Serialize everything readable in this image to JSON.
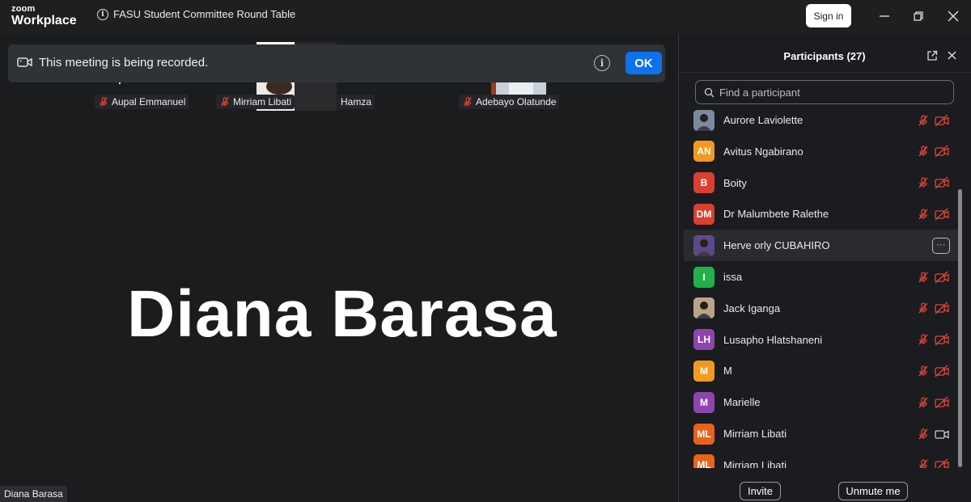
{
  "app": {
    "logo_line1": "zoom",
    "logo_line2": "Workplace",
    "meeting_title": "FASU Student Committee Round Table",
    "sign_in": "Sign in"
  },
  "recording_banner": {
    "text": "This meeting is being recorded.",
    "ok": "OK",
    "info_glyph": "i"
  },
  "video_tiles": [
    {
      "name": "Aupal Emmanuel",
      "muted": true
    },
    {
      "name": "Mirriam Libati",
      "muted": true
    },
    {
      "name": "Hamza",
      "muted": false
    },
    {
      "name": "Adebayo Olatunde",
      "muted": true
    }
  ],
  "active_speaker": {
    "display_name": "Diana Barasa",
    "self_label": "Diana Barasa"
  },
  "participants_panel": {
    "title": "Participants (27)",
    "search_placeholder": "Find a participant",
    "participants": [
      {
        "name": "Aurore Laviolette",
        "initials": "",
        "avatar_color": "#7a8aa0",
        "photo": true,
        "mic": "muted",
        "cam": "off"
      },
      {
        "name": "Avitus Ngabirano",
        "initials": "AN",
        "avatar_color": "#f29a1f",
        "photo": false,
        "mic": "muted",
        "cam": "off"
      },
      {
        "name": "Boity",
        "initials": "B",
        "avatar_color": "#d9402f",
        "photo": false,
        "mic": "muted",
        "cam": "off"
      },
      {
        "name": "Dr Malumbete Ralethe",
        "initials": "DM",
        "avatar_color": "#d9402f",
        "photo": false,
        "mic": "muted",
        "cam": "off"
      },
      {
        "name": "Herve orly CUBAHIRO",
        "initials": "",
        "avatar_color": "#5b4a8a",
        "photo": true,
        "mic": "hover",
        "cam": "hover",
        "more": "···"
      },
      {
        "name": "issa",
        "initials": "I",
        "avatar_color": "#22b04a",
        "photo": false,
        "mic": "muted",
        "cam": "off"
      },
      {
        "name": "Jack Iganga",
        "initials": "",
        "avatar_color": "#b9a48a",
        "photo": true,
        "mic": "muted",
        "cam": "off"
      },
      {
        "name": "Lusapho Hlatshaneni",
        "initials": "LH",
        "avatar_color": "#8e44ad",
        "photo": false,
        "mic": "muted",
        "cam": "off"
      },
      {
        "name": "M",
        "initials": "M",
        "avatar_color": "#f29a1f",
        "photo": false,
        "mic": "muted",
        "cam": "off"
      },
      {
        "name": "Marielle",
        "initials": "M",
        "avatar_color": "#8e44ad",
        "photo": false,
        "mic": "muted",
        "cam": "off"
      },
      {
        "name": "Mirriam Libati",
        "initials": "ML",
        "avatar_color": "#e8631a",
        "photo": false,
        "mic": "muted",
        "cam": "on"
      },
      {
        "name": "Mirriam Libati",
        "initials": "ML",
        "avatar_color": "#e8631a",
        "photo": false,
        "mic": "muted",
        "cam": "off"
      }
    ],
    "invite": "Invite",
    "unmute_me": "Unmute me"
  },
  "colors": {
    "accent_blue": "#0e72ed",
    "muted_red": "#e0463a"
  }
}
